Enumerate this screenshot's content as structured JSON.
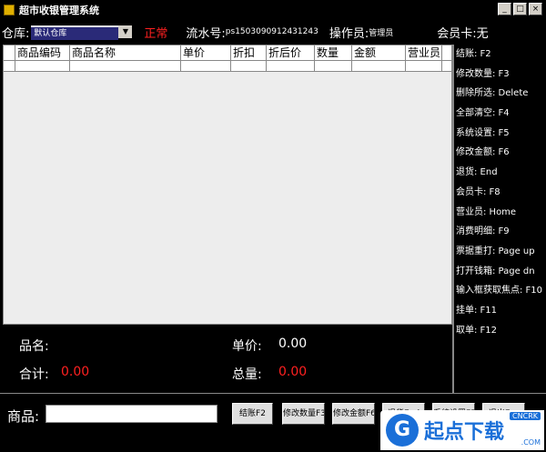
{
  "window": {
    "title": "超市收银管理系统",
    "controls": {
      "minimize": "_",
      "maximize": "□",
      "close": "×"
    }
  },
  "infobar": {
    "warehouse_label": "仓库:",
    "warehouse_value": "默认仓库",
    "status": "正常",
    "serial_label": "流水号:",
    "serial_value": "ps1503090912431243",
    "operator_label": "操作员:",
    "operator_value": "管理员",
    "member_label": "会员卡:",
    "member_value": "无"
  },
  "grid": {
    "columns": [
      "商品编码",
      "商品名称",
      "单价",
      "折扣",
      "折后价",
      "数量",
      "金额",
      "营业员"
    ]
  },
  "shortcuts": [
    "结账: F2",
    "修改数量: F3",
    "删除所选: Delete",
    "全部清空: F4",
    "系统设置: F5",
    "修改金额: F6",
    "退货: End",
    "会员卡: F8",
    "营业员: Home",
    "消费明细: F9",
    "票据重打: Page up",
    "打开钱箱: Page dn",
    "输入框获取焦点: F10",
    "挂单: F11",
    "取单: F12"
  ],
  "summary": {
    "name_label": "品名:",
    "price_label": "单价:",
    "price_value": "0.00",
    "total_label": "合计:",
    "total_value": "0.00",
    "qty_label": "总量:",
    "qty_value": "0.00"
  },
  "bottom": {
    "goods_label": "商品:",
    "goods_value": "",
    "buttons": [
      "结账F2",
      "修改数量F3",
      "修改金额F6",
      "退货End",
      "系统设置F5",
      "退出Esc"
    ]
  },
  "watermark": {
    "mark": "G",
    "text": "起点下载",
    "site": "CNCRK",
    "site2": ".COM"
  }
}
